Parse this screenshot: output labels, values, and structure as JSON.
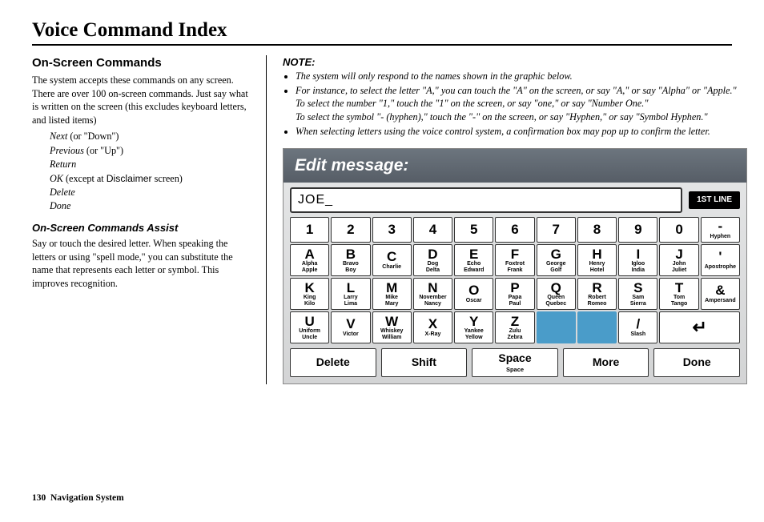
{
  "page_title": "Voice Command Index",
  "left": {
    "heading": "On-Screen Commands",
    "body1": "The system accepts these commands on any screen. There are over 100 on-screen commands. Just say what is written on the screen (this excludes keyboard letters, and listed items)",
    "cmds": [
      {
        "t": "Next",
        "paren": "(or \"Down\")"
      },
      {
        "t": "Previous",
        "paren": "(or \"Up\")"
      },
      {
        "t": "Return",
        "paren": ""
      },
      {
        "t": "OK",
        "paren": "(except at",
        "disc": "Disclaimer",
        "paren2": "screen)"
      },
      {
        "t": "Delete",
        "paren": ""
      },
      {
        "t": "Done",
        "paren": ""
      }
    ],
    "heading2": "On-Screen Commands Assist",
    "body2": "Say or touch the desired letter. When speaking the letters or using \"spell mode,\" you can substitute the name that represents each letter or symbol. This improves recognition."
  },
  "right": {
    "note_label": "NOTE:",
    "b1": "The system will only respond to the names shown in the graphic below.",
    "b2a": "For instance, to select the letter \"A,\" you can touch the \"A\" on the screen, or say \"A,\" or say \"Alpha\" or \"Apple.\"",
    "b2b": "To select the number \"1,\" touch the \"1\" on the screen, or say \"one,\" or say \"Number One.\"",
    "b2c": "To select the symbol \"- (hyphen),\" touch the \"-\" on the screen, or say \"Hyphen,\" or say \"Symbol Hyphen.\"",
    "b3": "When selecting letters using the voice control system, a confirmation box may pop up to confirm the letter."
  },
  "screen": {
    "title": "Edit message:",
    "input_value": "JOE_",
    "badge": "1ST LINE",
    "nums": [
      "1",
      "2",
      "3",
      "4",
      "5",
      "6",
      "7",
      "8",
      "9",
      "0"
    ],
    "hyphen": {
      "big": "-",
      "sm": "Hyphen"
    },
    "row2": [
      {
        "big": "A",
        "sm": "Alpha\nApple"
      },
      {
        "big": "B",
        "sm": "Bravo\nBoy"
      },
      {
        "big": "C",
        "sm": "Charlie"
      },
      {
        "big": "D",
        "sm": "Dog\nDelta"
      },
      {
        "big": "E",
        "sm": "Echo\nEdward"
      },
      {
        "big": "F",
        "sm": "Foxtrot\nFrank"
      },
      {
        "big": "G",
        "sm": "George\nGolf"
      },
      {
        "big": "H",
        "sm": "Henry\nHotel"
      },
      {
        "big": "I",
        "sm": "Igloo\nIndia"
      },
      {
        "big": "J",
        "sm": "John\nJuliet"
      },
      {
        "big": "'",
        "sm": "Apostrophe"
      }
    ],
    "row3": [
      {
        "big": "K",
        "sm": "King\nKilo"
      },
      {
        "big": "L",
        "sm": "Larry\nLima"
      },
      {
        "big": "M",
        "sm": "Mike\nMary"
      },
      {
        "big": "N",
        "sm": "November\nNancy"
      },
      {
        "big": "O",
        "sm": "Oscar"
      },
      {
        "big": "P",
        "sm": "Papa\nPaul"
      },
      {
        "big": "Q",
        "sm": "Queen\nQuebec"
      },
      {
        "big": "R",
        "sm": "Robert\nRomeo"
      },
      {
        "big": "S",
        "sm": "Sam\nSierra"
      },
      {
        "big": "T",
        "sm": "Tom\nTango"
      },
      {
        "big": "&",
        "sm": "Ampersand"
      }
    ],
    "row4": [
      {
        "big": "U",
        "sm": "Uniform\nUncle"
      },
      {
        "big": "V",
        "sm": "Victor"
      },
      {
        "big": "W",
        "sm": "Whiskey\nWilliam"
      },
      {
        "big": "X",
        "sm": "X-Ray"
      },
      {
        "big": "Y",
        "sm": "Yankee\nYellow"
      },
      {
        "big": "Z",
        "sm": "Zulu\nZebra"
      }
    ],
    "slash": {
      "big": "/",
      "sm": "Slash"
    },
    "bottom": [
      {
        "big": "Delete",
        "sm": ""
      },
      {
        "big": "Shift",
        "sm": ""
      },
      {
        "big": "Space",
        "sm": "Space"
      },
      {
        "big": "More",
        "sm": ""
      },
      {
        "big": "Done",
        "sm": ""
      }
    ]
  },
  "footer": {
    "page": "130",
    "label": "Navigation System"
  }
}
